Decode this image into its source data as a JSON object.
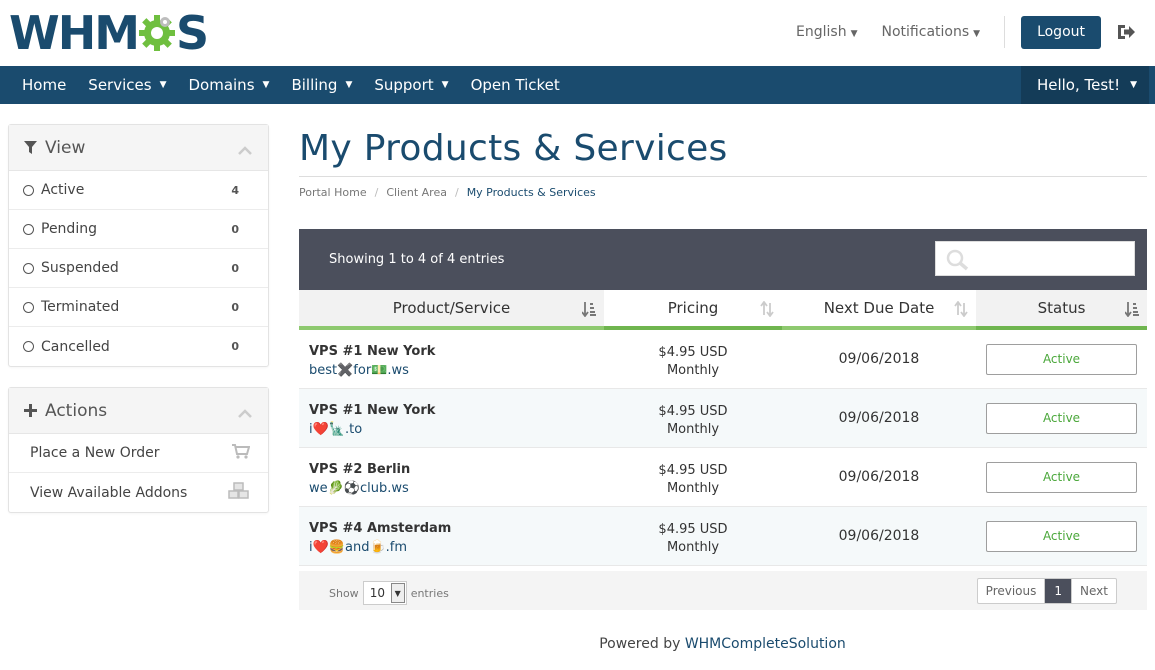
{
  "header": {
    "logo_text_left": "WHM",
    "logo_text_right": "S",
    "language": "English",
    "notifications": "Notifications",
    "logout": "Logout",
    "colors": {
      "brand": "#1a4b6e",
      "gear": "#6fbf3f"
    }
  },
  "nav": {
    "items": [
      {
        "label": "Home",
        "caret": false
      },
      {
        "label": "Services",
        "caret": true
      },
      {
        "label": "Domains",
        "caret": true
      },
      {
        "label": "Billing",
        "caret": true
      },
      {
        "label": "Support",
        "caret": true
      },
      {
        "label": "Open Ticket",
        "caret": false
      }
    ],
    "user": "Hello, Test!"
  },
  "sidebar": {
    "view": {
      "title": "View",
      "items": [
        {
          "label": "Active",
          "count": "4"
        },
        {
          "label": "Pending",
          "count": "0"
        },
        {
          "label": "Suspended",
          "count": "0"
        },
        {
          "label": "Terminated",
          "count": "0"
        },
        {
          "label": "Cancelled",
          "count": "0"
        }
      ]
    },
    "actions": {
      "title": "Actions",
      "items": [
        {
          "label": "Place a New Order",
          "icon": "cart-icon"
        },
        {
          "label": "View Available Addons",
          "icon": "cubes-icon"
        }
      ]
    }
  },
  "main": {
    "title": "My Products & Services",
    "breadcrumb": [
      "Portal Home",
      "Client Area",
      "My Products & Services"
    ],
    "table": {
      "showing": "Showing 1 to 4 of 4 entries",
      "columns": [
        "Product/Service",
        "Pricing",
        "Next Due Date",
        "Status"
      ],
      "rows": [
        {
          "product": "VPS #1 New York",
          "domain": "best✖️for💵.ws",
          "price": "$4.95 USD",
          "cycle": "Monthly",
          "due": "09/06/2018",
          "status": "Active"
        },
        {
          "product": "VPS #1 New York",
          "domain": "i❤️🗽.to",
          "price": "$4.95 USD",
          "cycle": "Monthly",
          "due": "09/06/2018",
          "status": "Active"
        },
        {
          "product": "VPS #2 Berlin",
          "domain": "we🥬⚽club.ws",
          "price": "$4.95 USD",
          "cycle": "Monthly",
          "due": "09/06/2018",
          "status": "Active"
        },
        {
          "product": "VPS #4 Amsterdam",
          "domain": "i❤️🍔and🍺.fm",
          "price": "$4.95 USD",
          "cycle": "Monthly",
          "due": "09/06/2018",
          "status": "Active"
        }
      ],
      "show_label": "Show",
      "entries_value": "10",
      "entries_label": "entries",
      "pager": {
        "previous": "Previous",
        "current": "1",
        "next": "Next"
      }
    }
  },
  "footer": {
    "prefix": "Powered by ",
    "link": "WHMCompleteSolution"
  }
}
